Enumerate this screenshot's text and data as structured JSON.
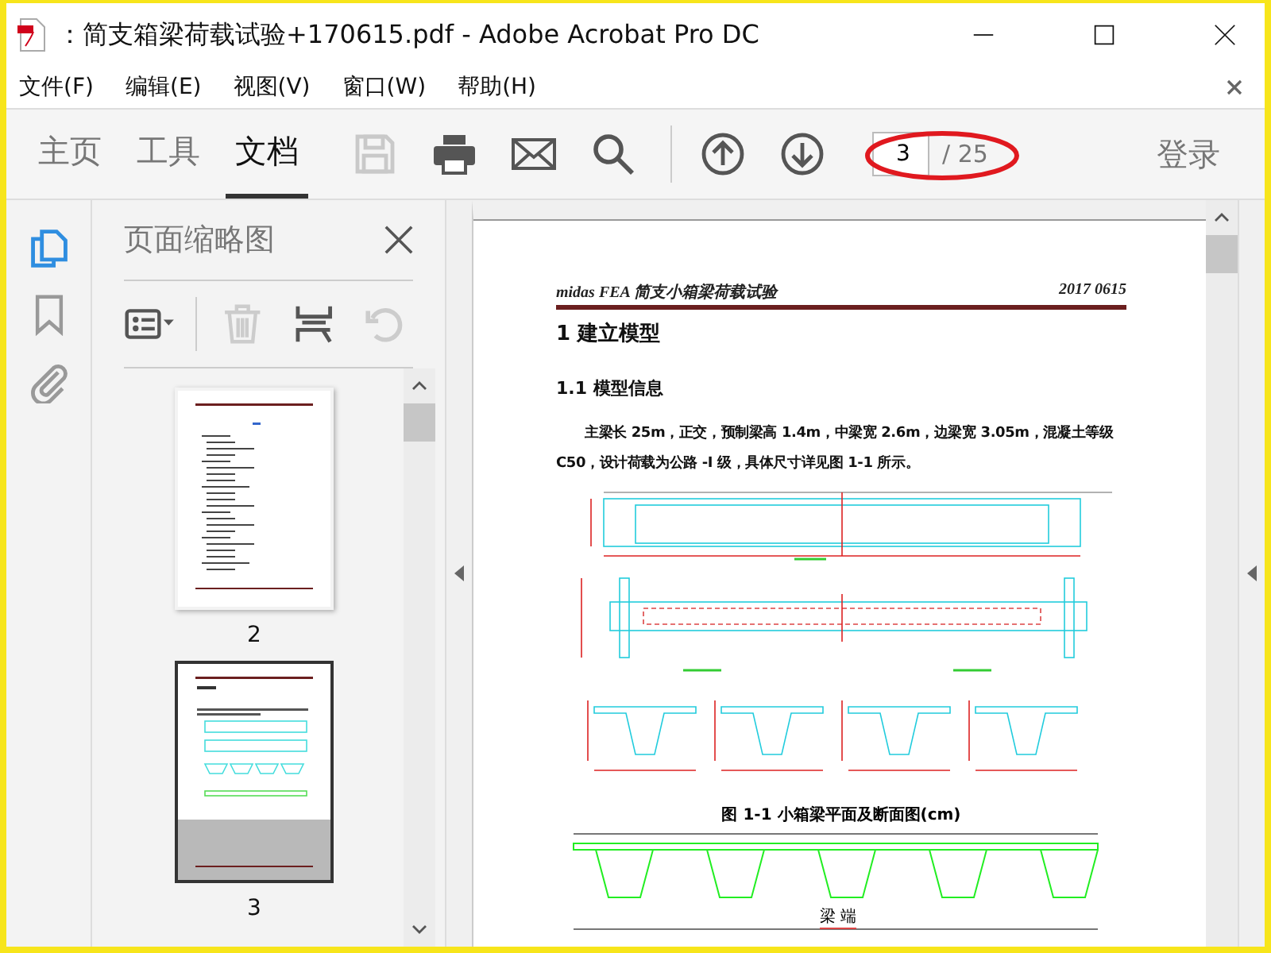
{
  "window": {
    "title": "：简支箱梁荷载试验+170615.pdf - Adobe Acrobat Pro DC"
  },
  "menu": [
    {
      "label": "文件(F)"
    },
    {
      "label": "编辑(E)"
    },
    {
      "label": "视图(V)"
    },
    {
      "label": "窗口(W)"
    },
    {
      "label": "帮助(H)"
    }
  ],
  "toolbar": {
    "tabs": [
      {
        "label": "主页",
        "selected": false
      },
      {
        "label": "工具",
        "selected": false
      },
      {
        "label": "文档",
        "selected": true
      }
    ],
    "tools": [
      {
        "kind": "save",
        "disabled": true
      },
      {
        "kind": "print",
        "disabled": false
      },
      {
        "kind": "mail",
        "disabled": false
      },
      {
        "kind": "search",
        "disabled": false
      }
    ],
    "nav": [
      {
        "kind": "up",
        "disabled": false
      },
      {
        "kind": "down",
        "disabled": false
      }
    ],
    "page_field": {
      "value": "3",
      "total": "/ 25"
    },
    "sign_in": "登录"
  },
  "side_rail": [
    {
      "kind": "pages",
      "selected": true
    },
    {
      "kind": "bookmark",
      "selected": false
    },
    {
      "kind": "attachment",
      "selected": false
    }
  ],
  "thumbnail_panel": {
    "title": "页面缩略图",
    "tools": [
      {
        "kind": "options",
        "disabled": false
      },
      {
        "kind": "delete",
        "disabled": true
      },
      {
        "kind": "insert",
        "disabled": false
      },
      {
        "kind": "rotate",
        "disabled": true
      }
    ],
    "thumbnails": [
      {
        "label": "2",
        "selected": false,
        "kind": "contents"
      },
      {
        "label": "3",
        "selected": true,
        "kind": "drawing"
      }
    ]
  },
  "document": {
    "header_left": "midas FEA 简支小箱梁荷载试验",
    "header_right": "2017 0615",
    "heading": "1 建立模型",
    "subheading": "1.1 模型信息",
    "paragraph": "主梁长 25m，正交，预制梁高 1.4m，中梁宽 2.6m，边梁宽 3.05m，混凝土等级 C50，设计荷载为公路 -I 级，具体尺寸详见图 1-1 所示。",
    "figure_caption": "图 1-1  小箱梁平面及断面图(cm)",
    "drawing_label": "梁 端"
  }
}
